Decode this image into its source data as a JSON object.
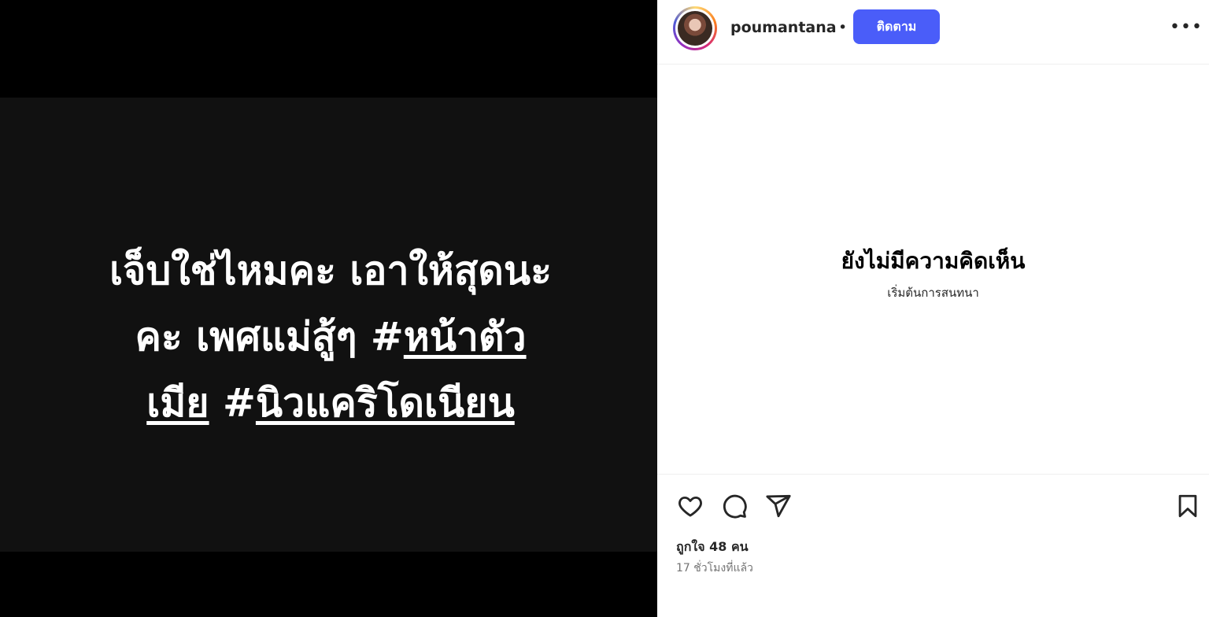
{
  "post_image": {
    "lines": [
      [
        "เจ็บใช่ไหมคะ เอาให้สุดนะ"
      ],
      [
        "คะ เพศแม่สู้ๆ #",
        "หน้าตัว"
      ],
      [
        "เมีย",
        " #",
        "นิวแคริโดเนียน"
      ]
    ],
    "line1": "เจ็บใช่ไหมคะ เอาให้สุดนะ",
    "line2_prefix": "คะ เพศแม่สู้ๆ #",
    "line2_tag": "หน้าตัว",
    "line3_tag_a": "เมีย",
    "line3_hash": " #",
    "line3_tag_b": "นิวแคริโดเนียน"
  },
  "header": {
    "username": "poumantana",
    "separator": "•",
    "follow_label": "ติดตาม",
    "more_label": "•••"
  },
  "comments": {
    "empty_title": "ยังไม่มีความคิดเห็น",
    "empty_subtitle": "เริ่มต้นการสนทนา"
  },
  "footer": {
    "likes": "ถูกใจ 48 คน",
    "timestamp": "17 ชั่วโมงที่แล้ว"
  },
  "colors": {
    "follow_button": "#4a5df9",
    "media_background": "#111111"
  },
  "icons": [
    "heart-icon",
    "comment-icon",
    "share-icon",
    "bookmark-icon",
    "more-icon"
  ]
}
